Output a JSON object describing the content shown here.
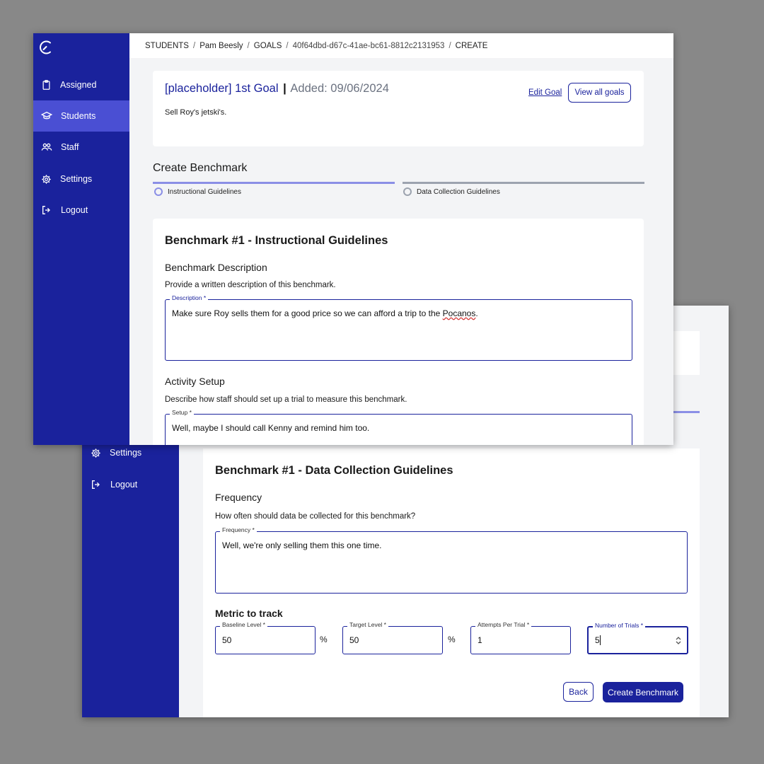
{
  "breadcrumb": {
    "students": "STUDENTS",
    "sep": "/",
    "student_name": "Pam Beesly",
    "goals": "GOALS",
    "goal_id": "40f64dbd-d67c-41ae-bc61-8812c2131953",
    "current": "CREATE"
  },
  "sidebar": {
    "items": [
      {
        "label": "Assigned",
        "icon": "clipboard-icon"
      },
      {
        "label": "Students",
        "icon": "graduation-cap-icon",
        "active": true
      },
      {
        "label": "Staff",
        "icon": "people-icon"
      },
      {
        "label": "Settings",
        "icon": "gear-icon"
      },
      {
        "label": "Logout",
        "icon": "logout-icon"
      }
    ]
  },
  "goal": {
    "title": "[placeholder] 1st Goal",
    "divider": "|",
    "added": "Added: 09/06/2024",
    "description": "Sell Roy's jetski's.",
    "edit_label": "Edit Goal",
    "view_all_label": "View all goals"
  },
  "create_benchmark": {
    "heading": "Create Benchmark",
    "steps": [
      "Instructional Guidelines",
      "Data Collection Guidelines"
    ]
  },
  "instructional": {
    "title": "Benchmark #1 - Instructional Guidelines",
    "description_heading": "Benchmark Description",
    "description_help": "Provide a written description of this benchmark.",
    "description_label": "Description *",
    "description_value_pre": "Make sure Roy sells them for a good price so we can afford a trip to the ",
    "description_value_misspelled": "Pocanos",
    "description_value_post": ".",
    "setup_heading": "Activity Setup",
    "setup_help": "Describe how staff should set up a trial to measure this benchmark.",
    "setup_label": "Setup *",
    "setup_value": "Well, maybe I should call Kenny and remind him too."
  },
  "data_collection": {
    "title": "Benchmark #1 - Data Collection Guidelines",
    "frequency_heading": "Frequency",
    "frequency_help": "How often should data be collected for this benchmark?",
    "frequency_label": "Frequency *",
    "frequency_value": "Well, we're only selling them this one time.",
    "metric_heading": "Metric to track",
    "baseline_label": "Baseline Level *",
    "baseline_value": "50",
    "target_label": "Target Level *",
    "target_value": "50",
    "percent": "%",
    "attempts_label": "Attempts Per Trial *",
    "attempts_value": "1",
    "trials_label": "Number of Trials *",
    "trials_value": "5",
    "back_label": "Back",
    "submit_label": "Create Benchmark"
  },
  "colors": {
    "sidebar": "#1a229c",
    "sidebar_active": "#4a4fd3",
    "accent": "#1a229c",
    "step_active": "#8b8fe6",
    "step_inactive": "#9ca3af",
    "background": "#888888"
  }
}
